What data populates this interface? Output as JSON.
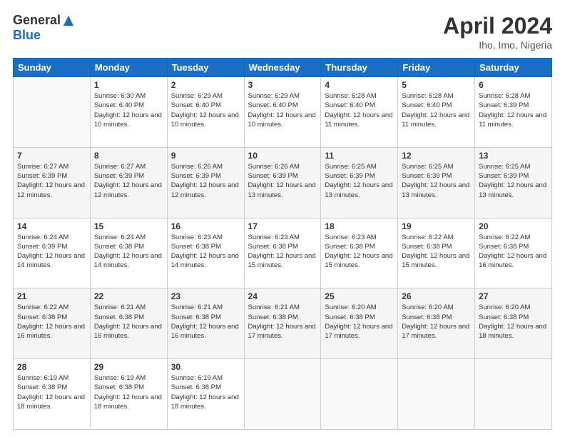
{
  "header": {
    "logo_general": "General",
    "logo_blue": "Blue",
    "month_title": "April 2024",
    "location": "Iho, Imo, Nigeria"
  },
  "days_of_week": [
    "Sunday",
    "Monday",
    "Tuesday",
    "Wednesday",
    "Thursday",
    "Friday",
    "Saturday"
  ],
  "weeks": [
    [
      {
        "day": "",
        "sunrise": "",
        "sunset": "",
        "daylight": ""
      },
      {
        "day": "1",
        "sunrise": "Sunrise: 6:30 AM",
        "sunset": "Sunset: 6:40 PM",
        "daylight": "Daylight: 12 hours and 10 minutes."
      },
      {
        "day": "2",
        "sunrise": "Sunrise: 6:29 AM",
        "sunset": "Sunset: 6:40 PM",
        "daylight": "Daylight: 12 hours and 10 minutes."
      },
      {
        "day": "3",
        "sunrise": "Sunrise: 6:29 AM",
        "sunset": "Sunset: 6:40 PM",
        "daylight": "Daylight: 12 hours and 10 minutes."
      },
      {
        "day": "4",
        "sunrise": "Sunrise: 6:28 AM",
        "sunset": "Sunset: 6:40 PM",
        "daylight": "Daylight: 12 hours and 11 minutes."
      },
      {
        "day": "5",
        "sunrise": "Sunrise: 6:28 AM",
        "sunset": "Sunset: 6:40 PM",
        "daylight": "Daylight: 12 hours and 11 minutes."
      },
      {
        "day": "6",
        "sunrise": "Sunrise: 6:28 AM",
        "sunset": "Sunset: 6:39 PM",
        "daylight": "Daylight: 12 hours and 11 minutes."
      }
    ],
    [
      {
        "day": "7",
        "sunrise": "Sunrise: 6:27 AM",
        "sunset": "Sunset: 6:39 PM",
        "daylight": "Daylight: 12 hours and 12 minutes."
      },
      {
        "day": "8",
        "sunrise": "Sunrise: 6:27 AM",
        "sunset": "Sunset: 6:39 PM",
        "daylight": "Daylight: 12 hours and 12 minutes."
      },
      {
        "day": "9",
        "sunrise": "Sunrise: 6:26 AM",
        "sunset": "Sunset: 6:39 PM",
        "daylight": "Daylight: 12 hours and 12 minutes."
      },
      {
        "day": "10",
        "sunrise": "Sunrise: 6:26 AM",
        "sunset": "Sunset: 6:39 PM",
        "daylight": "Daylight: 12 hours and 13 minutes."
      },
      {
        "day": "11",
        "sunrise": "Sunrise: 6:25 AM",
        "sunset": "Sunset: 6:39 PM",
        "daylight": "Daylight: 12 hours and 13 minutes."
      },
      {
        "day": "12",
        "sunrise": "Sunrise: 6:25 AM",
        "sunset": "Sunset: 6:39 PM",
        "daylight": "Daylight: 12 hours and 13 minutes."
      },
      {
        "day": "13",
        "sunrise": "Sunrise: 6:25 AM",
        "sunset": "Sunset: 6:39 PM",
        "daylight": "Daylight: 12 hours and 13 minutes."
      }
    ],
    [
      {
        "day": "14",
        "sunrise": "Sunrise: 6:24 AM",
        "sunset": "Sunset: 6:39 PM",
        "daylight": "Daylight: 12 hours and 14 minutes."
      },
      {
        "day": "15",
        "sunrise": "Sunrise: 6:24 AM",
        "sunset": "Sunset: 6:38 PM",
        "daylight": "Daylight: 12 hours and 14 minutes."
      },
      {
        "day": "16",
        "sunrise": "Sunrise: 6:23 AM",
        "sunset": "Sunset: 6:38 PM",
        "daylight": "Daylight: 12 hours and 14 minutes."
      },
      {
        "day": "17",
        "sunrise": "Sunrise: 6:23 AM",
        "sunset": "Sunset: 6:38 PM",
        "daylight": "Daylight: 12 hours and 15 minutes."
      },
      {
        "day": "18",
        "sunrise": "Sunrise: 6:23 AM",
        "sunset": "Sunset: 6:38 PM",
        "daylight": "Daylight: 12 hours and 15 minutes."
      },
      {
        "day": "19",
        "sunrise": "Sunrise: 6:22 AM",
        "sunset": "Sunset: 6:38 PM",
        "daylight": "Daylight: 12 hours and 15 minutes."
      },
      {
        "day": "20",
        "sunrise": "Sunrise: 6:22 AM",
        "sunset": "Sunset: 6:38 PM",
        "daylight": "Daylight: 12 hours and 16 minutes."
      }
    ],
    [
      {
        "day": "21",
        "sunrise": "Sunrise: 6:22 AM",
        "sunset": "Sunset: 6:38 PM",
        "daylight": "Daylight: 12 hours and 16 minutes."
      },
      {
        "day": "22",
        "sunrise": "Sunrise: 6:21 AM",
        "sunset": "Sunset: 6:38 PM",
        "daylight": "Daylight: 12 hours and 16 minutes."
      },
      {
        "day": "23",
        "sunrise": "Sunrise: 6:21 AM",
        "sunset": "Sunset: 6:38 PM",
        "daylight": "Daylight: 12 hours and 16 minutes."
      },
      {
        "day": "24",
        "sunrise": "Sunrise: 6:21 AM",
        "sunset": "Sunset: 6:38 PM",
        "daylight": "Daylight: 12 hours and 17 minutes."
      },
      {
        "day": "25",
        "sunrise": "Sunrise: 6:20 AM",
        "sunset": "Sunset: 6:38 PM",
        "daylight": "Daylight: 12 hours and 17 minutes."
      },
      {
        "day": "26",
        "sunrise": "Sunrise: 6:20 AM",
        "sunset": "Sunset: 6:38 PM",
        "daylight": "Daylight: 12 hours and 17 minutes."
      },
      {
        "day": "27",
        "sunrise": "Sunrise: 6:20 AM",
        "sunset": "Sunset: 6:38 PM",
        "daylight": "Daylight: 12 hours and 18 minutes."
      }
    ],
    [
      {
        "day": "28",
        "sunrise": "Sunrise: 6:19 AM",
        "sunset": "Sunset: 6:38 PM",
        "daylight": "Daylight: 12 hours and 18 minutes."
      },
      {
        "day": "29",
        "sunrise": "Sunrise: 6:19 AM",
        "sunset": "Sunset: 6:38 PM",
        "daylight": "Daylight: 12 hours and 18 minutes."
      },
      {
        "day": "30",
        "sunrise": "Sunrise: 6:19 AM",
        "sunset": "Sunset: 6:38 PM",
        "daylight": "Daylight: 12 hours and 18 minutes."
      },
      {
        "day": "",
        "sunrise": "",
        "sunset": "",
        "daylight": ""
      },
      {
        "day": "",
        "sunrise": "",
        "sunset": "",
        "daylight": ""
      },
      {
        "day": "",
        "sunrise": "",
        "sunset": "",
        "daylight": ""
      },
      {
        "day": "",
        "sunrise": "",
        "sunset": "",
        "daylight": ""
      }
    ]
  ]
}
